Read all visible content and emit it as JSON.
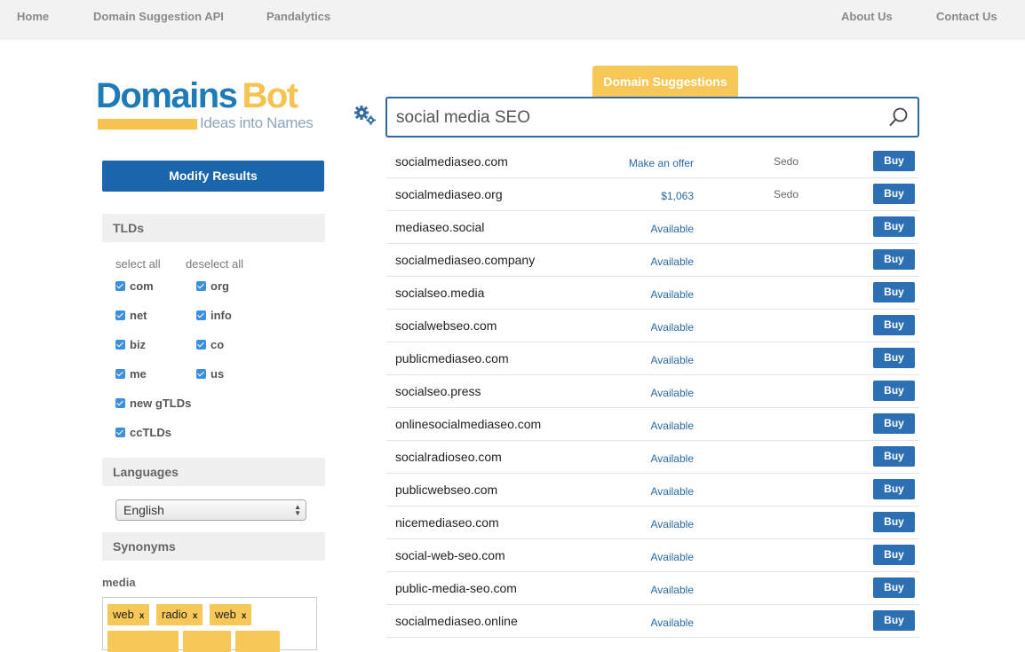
{
  "nav": {
    "home": "Home",
    "api": "Domain Suggestion API",
    "pandalytics": "Pandalytics",
    "about": "About Us",
    "contact": "Contact Us"
  },
  "logo": {
    "part1": "Domains",
    "part2": "Bot",
    "tagline": "Ideas into Names"
  },
  "sidebar": {
    "modify_label": "Modify Results",
    "tlds_title": "TLDs",
    "select_all": "select all",
    "deselect_all": "deselect all",
    "tlds": [
      "com",
      "org",
      "net",
      "info",
      "biz",
      "co",
      "me",
      "us",
      "new gTLDs",
      "ccTLDs"
    ],
    "languages_title": "Languages",
    "language_selected": "English",
    "synonyms_title": "Synonyms",
    "synonym_word": "media",
    "synonym_tags": [
      "web",
      "radio",
      "web"
    ]
  },
  "main": {
    "tab_label": "Domain Suggestions",
    "search_value": "social media SEO",
    "buy_label": "Buy",
    "results": [
      {
        "domain": "socialmediaseo.com",
        "status": "Make an offer",
        "market": "Sedo"
      },
      {
        "domain": "socialmediaseo.org",
        "status": "$1,063",
        "market": "Sedo"
      },
      {
        "domain": "mediaseo.social",
        "status": "Available",
        "market": ""
      },
      {
        "domain": "socialmediaseo.company",
        "status": "Available",
        "market": ""
      },
      {
        "domain": "socialseo.media",
        "status": "Available",
        "market": ""
      },
      {
        "domain": "socialwebseo.com",
        "status": "Available",
        "market": ""
      },
      {
        "domain": "publicmediaseo.com",
        "status": "Available",
        "market": ""
      },
      {
        "domain": "socialseo.press",
        "status": "Available",
        "market": ""
      },
      {
        "domain": "onlinesocialmediaseo.com",
        "status": "Available",
        "market": ""
      },
      {
        "domain": "socialradioseo.com",
        "status": "Available",
        "market": ""
      },
      {
        "domain": "publicwebseo.com",
        "status": "Available",
        "market": ""
      },
      {
        "domain": "nicemediaseo.com",
        "status": "Available",
        "market": ""
      },
      {
        "domain": "social-web-seo.com",
        "status": "Available",
        "market": ""
      },
      {
        "domain": "public-media-seo.com",
        "status": "Available",
        "market": ""
      },
      {
        "domain": "socialmediaseo.online",
        "status": "Available",
        "market": ""
      }
    ]
  },
  "colors": {
    "brand_blue": "#1f7bb8",
    "brand_yellow": "#f7c24f",
    "button_blue": "#1a66ad"
  }
}
